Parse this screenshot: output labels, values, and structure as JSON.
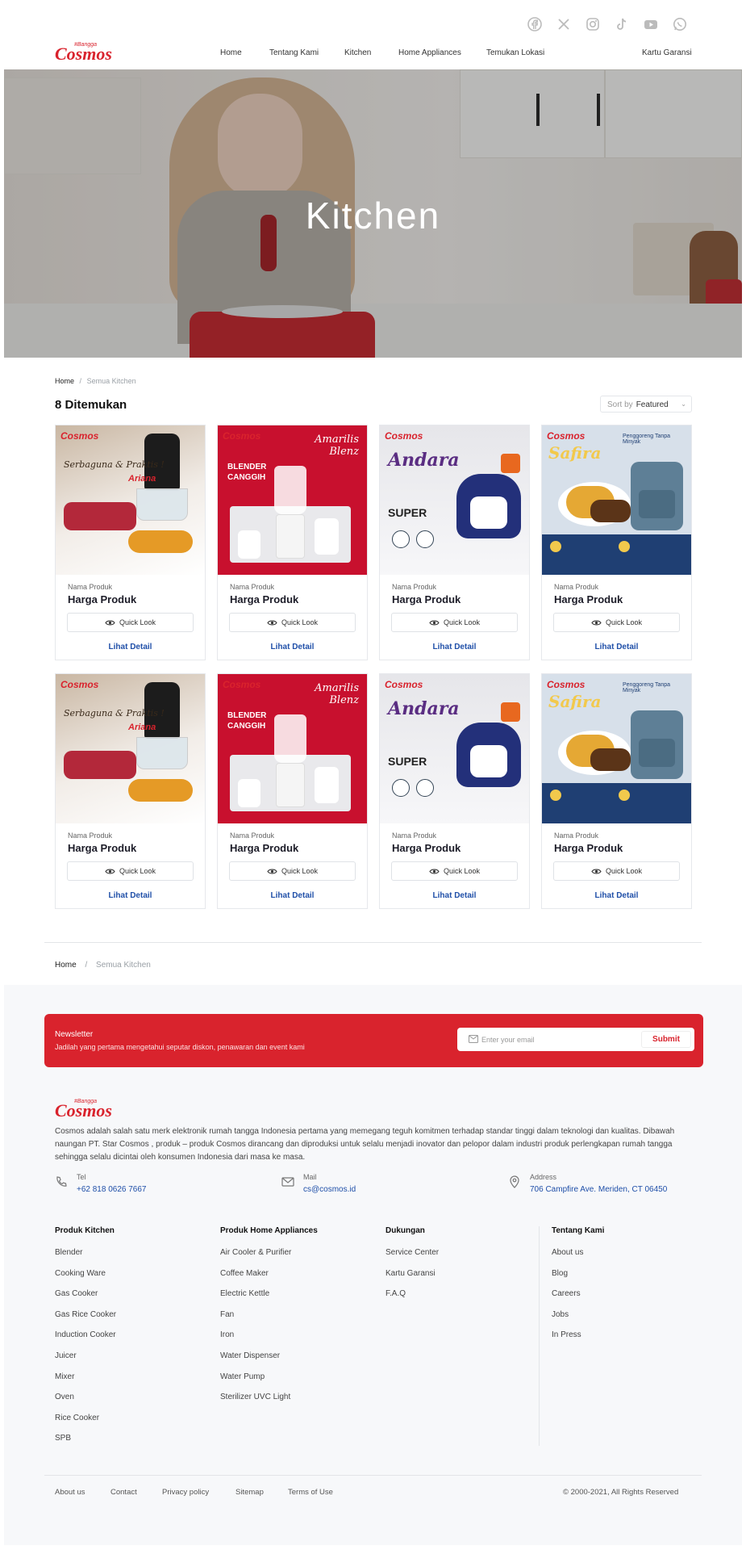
{
  "header": {
    "brand": "Cosmos",
    "brand_tagline": "#Bangga",
    "social_icons": [
      "facebook-icon",
      "x-icon",
      "instagram-icon",
      "tiktok-icon",
      "youtube-icon",
      "whatsapp-icon"
    ],
    "nav": [
      "Home",
      "Tentang Kami",
      "Kitchen",
      "Home Appliances",
      "Temukan Lokasi"
    ],
    "warranty_link": "Kartu Garansi"
  },
  "hero": {
    "title": "Kitchen"
  },
  "breadcrumb": {
    "home": "Home",
    "separator": "/",
    "current": "Semua Kitchen"
  },
  "listing": {
    "count_label": "8 Ditemukan",
    "sort_label": "Sort by",
    "sort_value": "Featured"
  },
  "products": [
    {
      "name": "Nama Produk",
      "price": "Harga Produk",
      "quick_look": "Quick Look",
      "detail": "Lihat Detail",
      "image": "chopper-ariana",
      "img_text": "Serbaguna & Praktis !",
      "sub_text": "Ariana"
    },
    {
      "name": "Nama Produk",
      "price": "Harga Produk",
      "quick_look": "Quick Look",
      "detail": "Lihat Detail",
      "image": "blender-amarilis",
      "img_text": "BLENDER CANGGIH",
      "sub_text": "Amarilis Blenz"
    },
    {
      "name": "Nama Produk",
      "price": "Harga Produk",
      "quick_look": "Quick Look",
      "detail": "Lihat Detail",
      "image": "rice-cooker-andara",
      "img_text": "Andara",
      "sub_text": "SUPER"
    },
    {
      "name": "Nama Produk",
      "price": "Harga Produk",
      "quick_look": "Quick Look",
      "detail": "Lihat Detail",
      "image": "air-fryer-safira",
      "img_text": "Safira",
      "sub_text": "Penggoreng Tanpa Minyak"
    },
    {
      "name": "Nama Produk",
      "price": "Harga Produk",
      "quick_look": "Quick Look",
      "detail": "Lihat Detail",
      "image": "chopper-ariana",
      "img_text": "Serbaguna & Praktis !",
      "sub_text": "Ariana"
    },
    {
      "name": "Nama Produk",
      "price": "Harga Produk",
      "quick_look": "Quick Look",
      "detail": "Lihat Detail",
      "image": "blender-amarilis",
      "img_text": "BLENDER CANGGIH",
      "sub_text": "Amarilis Blenz"
    },
    {
      "name": "Nama Produk",
      "price": "Harga Produk",
      "quick_look": "Quick Look",
      "detail": "Lihat Detail",
      "image": "rice-cooker-andara",
      "img_text": "Andara",
      "sub_text": "SUPER"
    },
    {
      "name": "Nama Produk",
      "price": "Harga Produk",
      "quick_look": "Quick Look",
      "detail": "Lihat Detail",
      "image": "air-fryer-safira",
      "img_text": "Safira",
      "sub_text": "Penggoreng Tanpa Minyak"
    }
  ],
  "newsletter": {
    "title": "Newsletter",
    "subtitle": "Jadilah yang pertama mengetahui seputar diskon, penawaran dan event kami",
    "placeholder": "Enter your email",
    "submit": "Submit"
  },
  "footer": {
    "brand": "Cosmos",
    "about": "Cosmos adalah salah satu merk elektronik rumah tangga Indonesia pertama yang memegang teguh komitmen terhadap standar tinggi dalam teknologi dan kualitas. Dibawah naungan PT. Star Cosmos , produk – produk Cosmos dirancang dan diproduksi untuk selalu menjadi inovator dan pelopor dalam industri produk perlengkapan rumah tangga sehingga selalu dicintai oleh konsumen Indonesia dari masa ke masa.",
    "contacts": [
      {
        "label": "Tel",
        "value": "+62 818 0626 7667",
        "icon": "phone-icon"
      },
      {
        "label": "Mail",
        "value": "cs@cosmos.id",
        "icon": "mail-icon"
      },
      {
        "label": "Address",
        "value": "706 Campfire Ave. Meriden, CT 06450",
        "icon": "location-icon"
      }
    ],
    "columns": [
      {
        "title": "Produk Kitchen",
        "items": [
          "Blender",
          "Cooking Ware",
          "Gas Cooker",
          "Gas Rice Cooker",
          "Induction Cooker",
          "Juicer",
          "Mixer",
          "Oven",
          "Rice Cooker",
          "SPB"
        ]
      },
      {
        "title": "Produk Home Appliances",
        "items": [
          "Air Cooler & Purifier",
          "Coffee Maker",
          "Electric Kettle",
          "Fan",
          "Iron",
          "Water Dispenser",
          "Water Pump",
          "Sterilizer UVC Light"
        ]
      },
      {
        "title": "Dukungan",
        "items": [
          "Service Center",
          "Kartu Garansi",
          "F.A.Q"
        ]
      },
      {
        "title": "Tentang Kami",
        "items": [
          "About us",
          "Blog",
          "Careers",
          "Jobs",
          "In Press"
        ]
      }
    ],
    "bottom_links": [
      "About us",
      "Contact",
      "Privacy policy",
      "Sitemap",
      "Terms of Use"
    ],
    "copyright": "© 2000-2021, All Rights Reserved"
  },
  "colors": {
    "brand_red": "#d9232d",
    "link_blue": "#1f4fa8"
  }
}
